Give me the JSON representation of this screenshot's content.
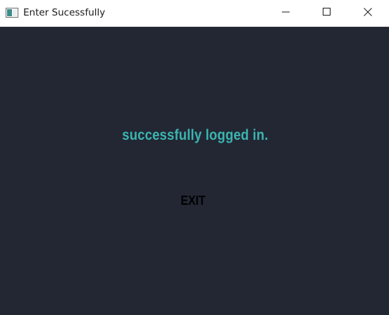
{
  "window": {
    "title": "Enter Sucessfully"
  },
  "titlebar": {
    "icon": "window-app-icon",
    "minimize_icon": "minimize-icon",
    "maximize_icon": "maximize-icon",
    "close_icon": "close-icon"
  },
  "main": {
    "message": "successfully logged in.",
    "exit_label": "EXIT"
  },
  "colors": {
    "background": "#222733",
    "titlebar": "#ffffff",
    "message": "#3cb4b0",
    "exit_text": "#000000"
  }
}
